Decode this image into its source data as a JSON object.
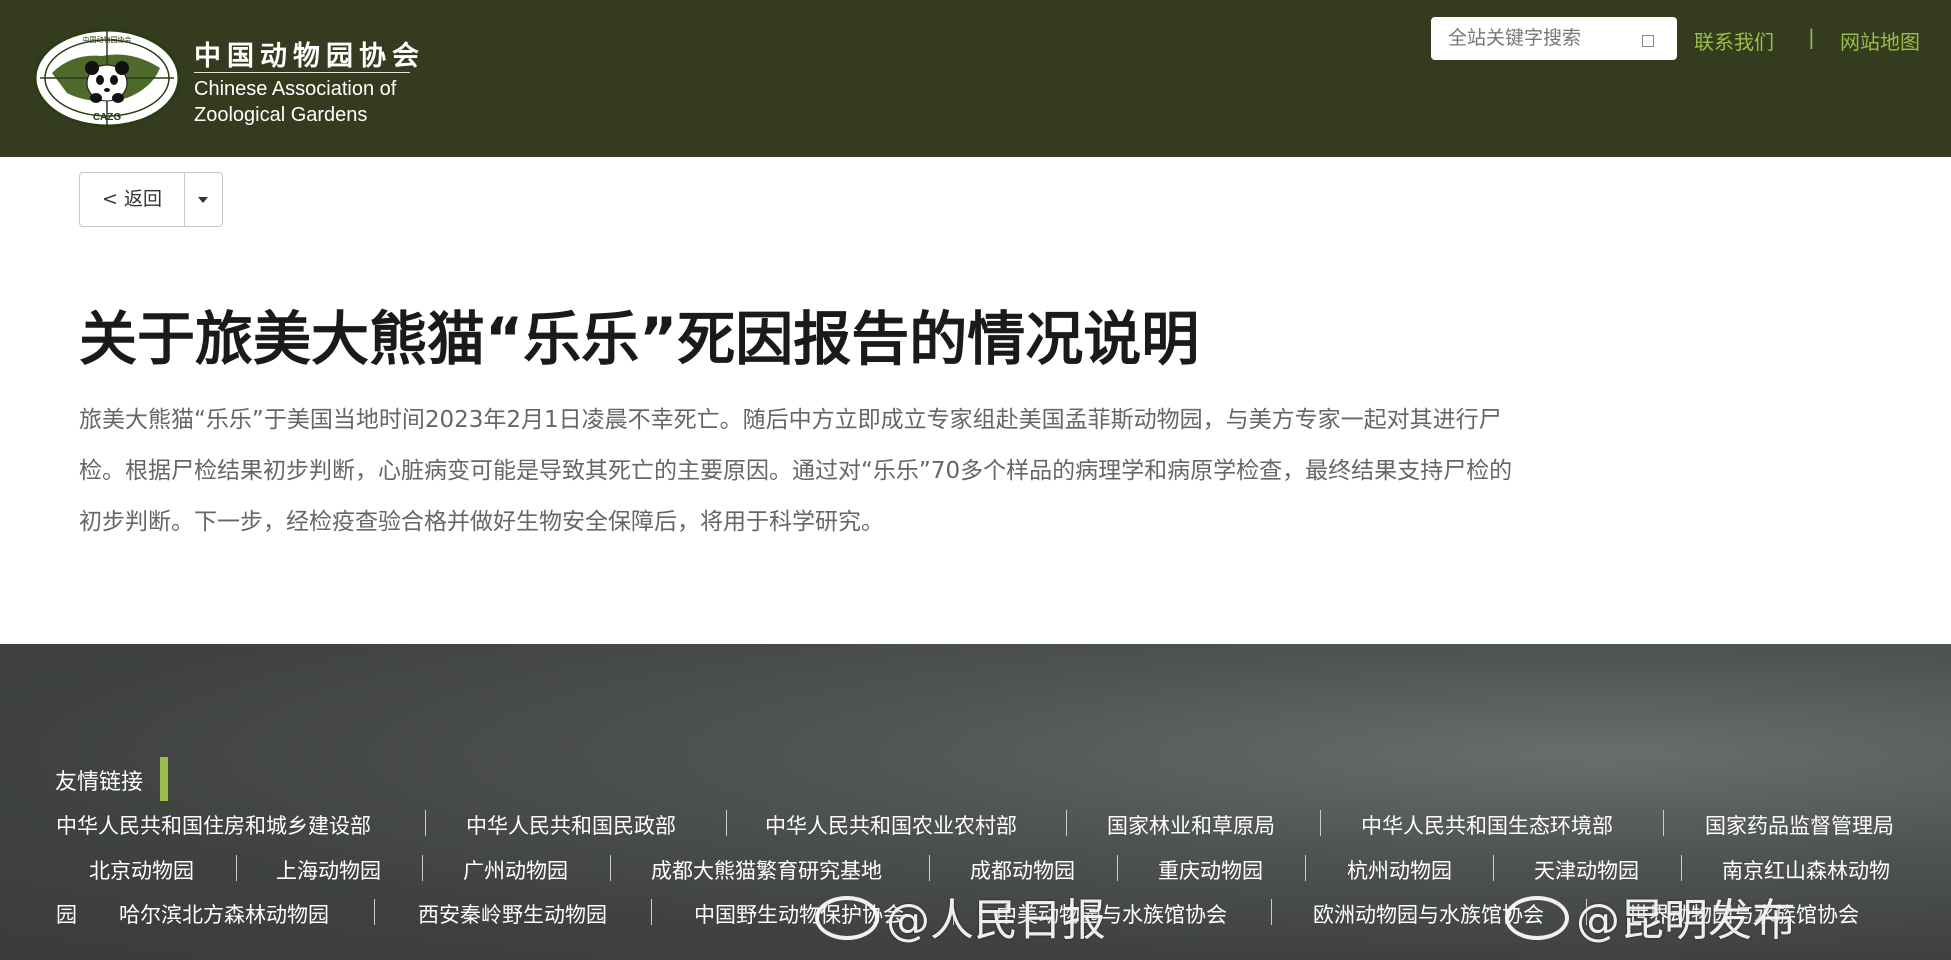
{
  "header": {
    "logo": {
      "cn_name": "中国动物园协会",
      "en_line1": "Chinese Association of",
      "en_line2": "Zoological Gardens",
      "emblem_text": "CAZG",
      "emblem_top_text": "中国动物园协会"
    },
    "search": {
      "placeholder": "全站关键字搜索"
    },
    "links": {
      "contact": "联系我们",
      "separator": "|",
      "sitemap": "网站地图"
    },
    "colors": {
      "background": "#343b1f",
      "link": "#9bbd4a"
    }
  },
  "toolbar": {
    "back_label": "< 返回"
  },
  "article": {
    "title": "关于旅美大熊猫“乐乐”死因报告的情况说明",
    "body": "旅美大熊猫“乐乐”于美国当地时间2023年2月1日凌晨不幸死亡。随后中方立即成立专家组赴美国孟菲斯动物园，与美方专家一起对其进行尸检。根据尸检结果初步判断，心脏病变可能是导致其死亡的主要原因。通过对“乐乐”70多个样品的病理学和病原学检查，最终结果支持尸检的初步判断。下一步，经检疫查验合格并做好生物安全保障后，将用于科学研究。"
  },
  "footer": {
    "title": "友情链接",
    "row1": [
      "中华人民共和国住房和城乡建设部",
      "中华人民共和国民政部",
      "中华人民共和国农业农村部",
      "国家林业和草原局",
      "中华人民共和国生态环境部",
      "国家药品监督管理局"
    ],
    "row2": [
      "北京动物园",
      "上海动物园",
      "广州动物园",
      "成都大熊猫繁育研究基地",
      "成都动物园",
      "重庆动物园",
      "杭州动物园",
      "天津动物园",
      "南京红山森林动物"
    ],
    "row3": [
      "园",
      "哈尔滨北方森林动物园",
      "西安秦岭野生动物园",
      "中国野生动物保护协会",
      "中美动物园与水族馆协会",
      "欧洲动物园与水族馆协会",
      "世界动物园与水族馆协会"
    ],
    "watermarks": [
      "@人民日报",
      "@昆明发布"
    ]
  }
}
